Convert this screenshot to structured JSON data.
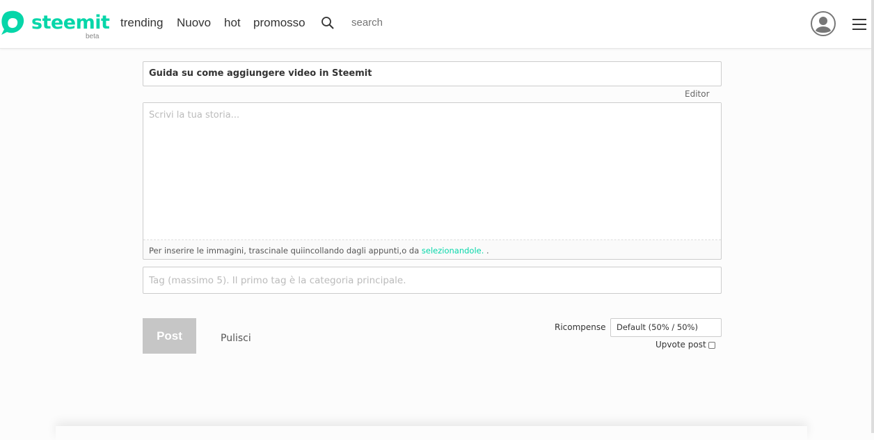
{
  "header": {
    "brand": "steemit",
    "beta": "beta",
    "nav": [
      "trending",
      "Nuovo",
      "hot",
      "promosso"
    ],
    "search_placeholder": "search",
    "brand_color": "#06d6a9"
  },
  "editor": {
    "title_value": "Guida su come aggiungere video in Steemit",
    "mode_label": "Editor",
    "body_placeholder": "Scrivi la tua storia...",
    "hint_text": "Per inserire le immagini, trascinale quiincollando dagli appunti,o da ",
    "hint_link": "selezionandole.",
    "hint_suffix": " .",
    "tags_placeholder": "Tag (massimo 5). Il primo tag è la categoria principale."
  },
  "actions": {
    "post": "Post",
    "clear": "Pulisci",
    "rewards_label": "Ricompense",
    "rewards_value": "Default (50% / 50%)",
    "upvote_label": "Upvote post",
    "upvote_checked": false
  }
}
